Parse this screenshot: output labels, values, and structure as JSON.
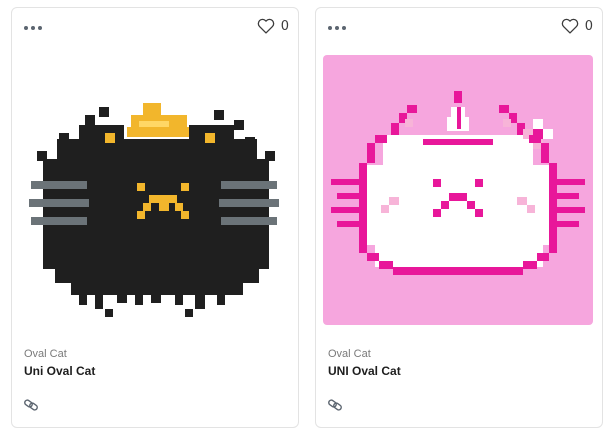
{
  "cards": [
    {
      "collection": "Oval Cat",
      "title": "Uni Oval Cat",
      "likes": "0",
      "art_background": "#ffffff",
      "art_description_icon": "black-pixel-cat-with-gold-crown"
    },
    {
      "collection": "Oval Cat",
      "title": "UNI Oval Cat",
      "likes": "0",
      "art_background": "#f6a6de",
      "art_description_icon": "pink-pixel-cat-unicorn"
    }
  ],
  "colors": {
    "border": "#e3e3e3",
    "black_cat": "#1f1f1f",
    "gold": "#f2b62c",
    "whisker_gray": "#6b7378",
    "pink_bg": "#f6a6de",
    "magenta": "#e8179a",
    "light_pink": "#f7b4d8"
  },
  "icons": {
    "menu": "more-horizontal-icon",
    "like": "heart-outline-icon",
    "link": "link-icon"
  }
}
